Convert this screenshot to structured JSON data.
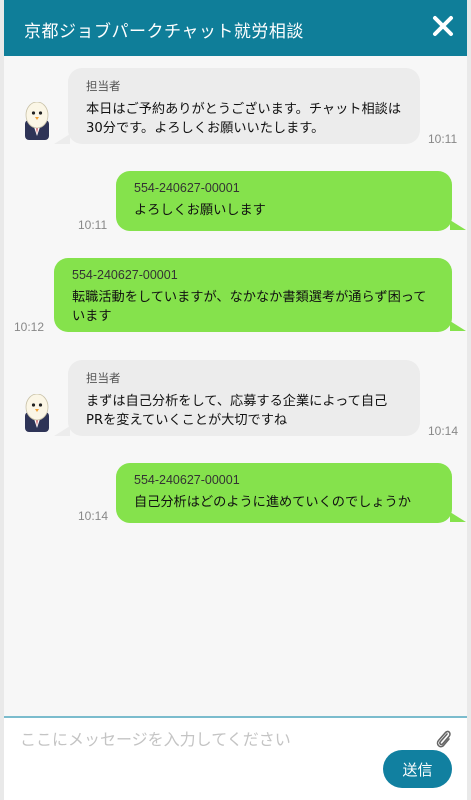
{
  "header": {
    "title": "京都ジョブパークチャット就労相談"
  },
  "messages": [
    {
      "from": "staff",
      "sender": "担当者",
      "text": "本日はご予約ありがとうございます。チャット相談は30分です。よろしくお願いいたします。",
      "time": "10:11"
    },
    {
      "from": "user",
      "sender": "554-240627-00001",
      "text": "よろしくお願いします",
      "time": "10:11"
    },
    {
      "from": "user",
      "sender": "554-240627-00001",
      "text": "転職活動をしていますが、なかなか書類選考が通らず困っています",
      "time": "10:12"
    },
    {
      "from": "staff",
      "sender": "担当者",
      "text": "まずは自己分析をして、応募する企業によって自己PRを変えていくことが大切ですね",
      "time": "10:14"
    },
    {
      "from": "user",
      "sender": "554-240627-00001",
      "text": "自己分析はどのように進めていくのでしょうか",
      "time": "10:14"
    }
  ],
  "composer": {
    "placeholder": "ここにメッセージを入力してください",
    "send_label": "送信"
  },
  "colors": {
    "header": "#0f7e99",
    "user_bubble": "#85e24c",
    "staff_bubble": "#ececec",
    "send_button": "#1180a0"
  },
  "icons": {
    "close": "close-icon",
    "attach": "paperclip-icon",
    "avatar": "mascot-avatar"
  }
}
